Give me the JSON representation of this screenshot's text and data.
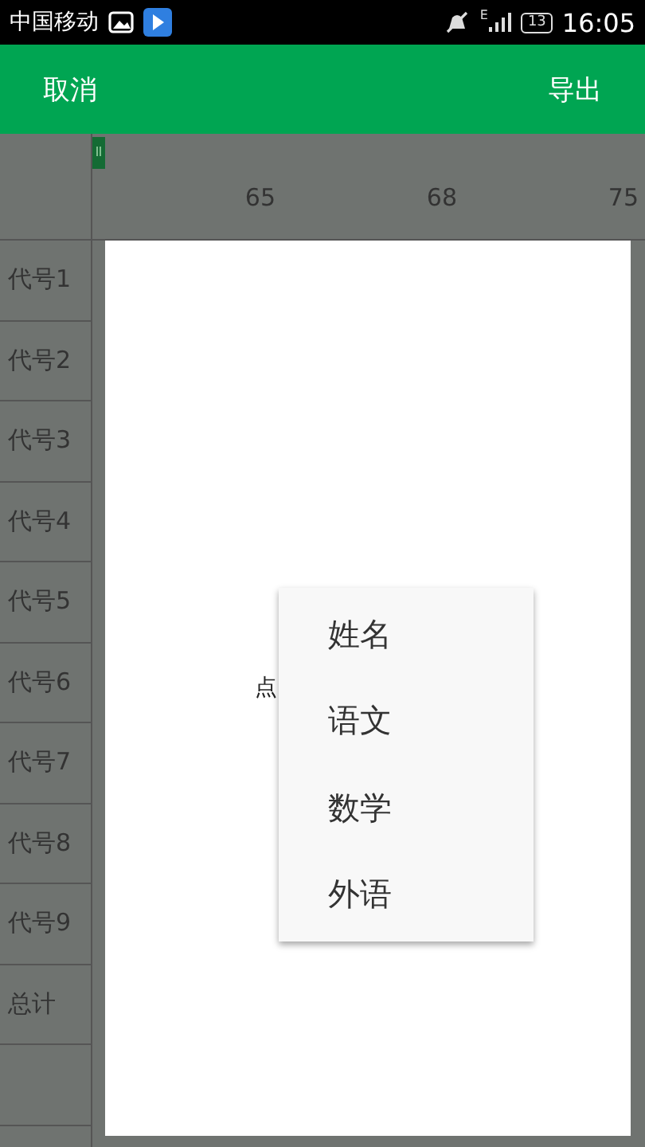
{
  "status_bar": {
    "carrier": "中国移动",
    "network": "E",
    "battery": "13",
    "time": "16:05"
  },
  "toolbar": {
    "cancel": "取消",
    "export": "导出"
  },
  "columns": [
    "65",
    "68",
    "75"
  ],
  "rows": [
    "代号1",
    "代号2",
    "代号3",
    "代号4",
    "代号5",
    "代号6",
    "代号7",
    "代号8",
    "代号9",
    "总计"
  ],
  "dialog": {
    "text": "点"
  },
  "menu": {
    "items": [
      "姓名",
      "语文",
      "数学",
      "外语"
    ]
  }
}
